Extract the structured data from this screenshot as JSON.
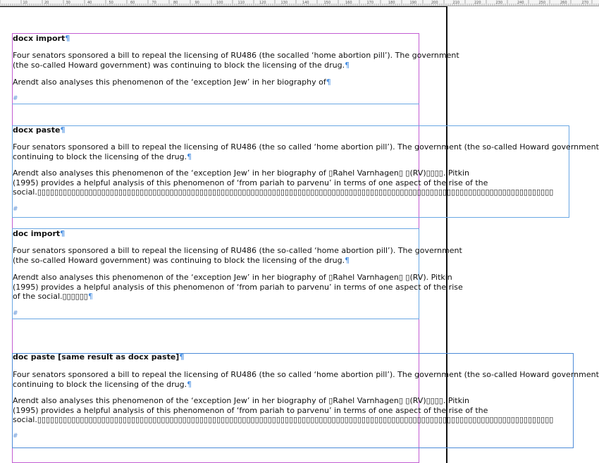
{
  "ruler": {
    "ticks": [
      "10",
      "20",
      "30",
      "40",
      "50",
      "60",
      "70",
      "80",
      "90",
      "100",
      "110",
      "120",
      "130",
      "140",
      "150",
      "160",
      "170",
      "180",
      "190",
      "200",
      "210",
      "220",
      "230",
      "240",
      "250",
      "260",
      "270"
    ]
  },
  "sections": [
    {
      "heading": "docx import",
      "p1_line1": "Four senators sponsored a bill to repeal the licensing of RU486 (the socalled ‘home abortion pill’). The government",
      "p1_line2": "(the so-called Howard government) was continuing to block the licensing of the drug.",
      "p2_line1": "Arendt also analyses this phenomenon of the ‘exception Jew’ in her biography of",
      "hash": "#"
    },
    {
      "heading": "docx paste",
      "p1_line1": "Four senators sponsored a bill to repeal the licensing of RU486 (the so called ‘home abortion pill’). The government (the so-called Howard government) was",
      "p1_line2": "continuing to block the licensing of the drug.",
      "p2_line1": "Arendt also analyses this phenomenon of the ‘exception Jew’ in her biography of ▯Rahel Varnhagen▯ ▯(RV)▯▯▯▯. Pitkin",
      "p2_line2": "(1995) provides a helpful analysis of this phenomenon of ‘from pariah to parvenu’ in terms of one aspect of the rise of the",
      "p2_line3": "social.▯▯▯▯▯▯▯▯▯▯▯▯▯▯▯▯▯▯▯▯▯▯▯▯▯▯▯▯▯▯▯▯▯▯▯▯▯▯▯▯▯▯▯▯▯▯▯▯▯▯▯▯▯▯▯▯▯▯▯▯▯▯▯▯▯▯▯▯▯▯▯▯▯▯▯▯▯▯▯▯▯▯▯▯▯▯▯▯▯▯▯▯▯▯▯▯▯▯▯▯▯▯▯▯▯▯▯▯▯▯▯▯▯▯▯▯▯▯▯▯▯",
      "hash": "#"
    },
    {
      "heading": "doc import",
      "p1_line1": "Four senators sponsored a bill to repeal the licensing of RU486 (the so-called ‘home abortion pill’). The government",
      "p1_line2": "(the so-called Howard government) was continuing to block the licensing of the drug.",
      "p2_line1": "Arendt also analyses this phenomenon of the ‘exception Jew’ in her biography of ▯Rahel Varnhagen▯ ▯(RV). Pitkin",
      "p2_line2": "(1995) provides a helpful analysis of this phenomenon of ‘from pariah to parvenu’ in terms of one aspect of the rise",
      "p2_line3": "of the social.▯▯▯▯▯▯",
      "hash": "#"
    },
    {
      "heading": "doc paste [same result as docx paste]",
      "p1_line1": "Four senators sponsored a bill to repeal the licensing of RU486 (the so called ‘home abortion pill’). The government (the so-called Howard government) was",
      "p1_line2": "continuing to block the licensing of the drug.",
      "p2_line1": "Arendt also analyses this phenomenon of the ‘exception Jew’ in her biography of ▯Rahel Varnhagen▯ ▯(RV)▯▯▯▯. Pitkin",
      "p2_line2": "(1995) provides a helpful analysis of this phenomenon of ‘from pariah to parvenu’ in terms of one aspect of the rise of the",
      "p2_line3": "social.▯▯▯▯▯▯▯▯▯▯▯▯▯▯▯▯▯▯▯▯▯▯▯▯▯▯▯▯▯▯▯▯▯▯▯▯▯▯▯▯▯▯▯▯▯▯▯▯▯▯▯▯▯▯▯▯▯▯▯▯▯▯▯▯▯▯▯▯▯▯▯▯▯▯▯▯▯▯▯▯▯▯▯▯▯▯▯▯▯▯▯▯▯▯▯▯▯▯▯▯▯▯▯▯▯▯▯▯▯▯▯▯▯▯▯▯▯▯▯▯▯",
      "hash": "#"
    }
  ],
  "pilcrow": "¶",
  "colors": {
    "frame_purple": "#c25dd3",
    "frame_blue": "#6aa7e3",
    "pilcrow": "#4a90e2"
  }
}
